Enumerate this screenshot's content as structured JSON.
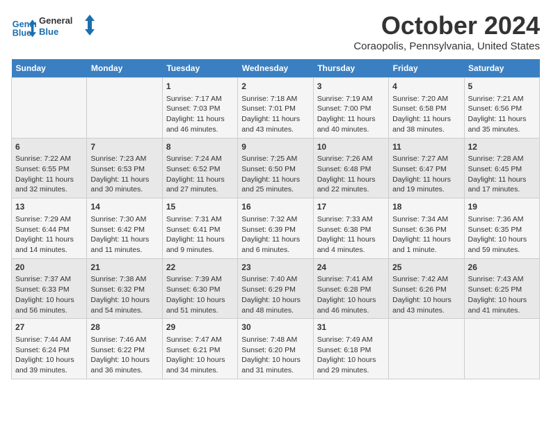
{
  "header": {
    "logo_line1": "General",
    "logo_line2": "Blue",
    "month": "October 2024",
    "location": "Coraopolis, Pennsylvania, United States"
  },
  "days_of_week": [
    "Sunday",
    "Monday",
    "Tuesday",
    "Wednesday",
    "Thursday",
    "Friday",
    "Saturday"
  ],
  "weeks": [
    [
      {
        "day": "",
        "content": ""
      },
      {
        "day": "",
        "content": ""
      },
      {
        "day": "1",
        "content": "Sunrise: 7:17 AM\nSunset: 7:03 PM\nDaylight: 11 hours and 46 minutes."
      },
      {
        "day": "2",
        "content": "Sunrise: 7:18 AM\nSunset: 7:01 PM\nDaylight: 11 hours and 43 minutes."
      },
      {
        "day": "3",
        "content": "Sunrise: 7:19 AM\nSunset: 7:00 PM\nDaylight: 11 hours and 40 minutes."
      },
      {
        "day": "4",
        "content": "Sunrise: 7:20 AM\nSunset: 6:58 PM\nDaylight: 11 hours and 38 minutes."
      },
      {
        "day": "5",
        "content": "Sunrise: 7:21 AM\nSunset: 6:56 PM\nDaylight: 11 hours and 35 minutes."
      }
    ],
    [
      {
        "day": "6",
        "content": "Sunrise: 7:22 AM\nSunset: 6:55 PM\nDaylight: 11 hours and 32 minutes."
      },
      {
        "day": "7",
        "content": "Sunrise: 7:23 AM\nSunset: 6:53 PM\nDaylight: 11 hours and 30 minutes."
      },
      {
        "day": "8",
        "content": "Sunrise: 7:24 AM\nSunset: 6:52 PM\nDaylight: 11 hours and 27 minutes."
      },
      {
        "day": "9",
        "content": "Sunrise: 7:25 AM\nSunset: 6:50 PM\nDaylight: 11 hours and 25 minutes."
      },
      {
        "day": "10",
        "content": "Sunrise: 7:26 AM\nSunset: 6:48 PM\nDaylight: 11 hours and 22 minutes."
      },
      {
        "day": "11",
        "content": "Sunrise: 7:27 AM\nSunset: 6:47 PM\nDaylight: 11 hours and 19 minutes."
      },
      {
        "day": "12",
        "content": "Sunrise: 7:28 AM\nSunset: 6:45 PM\nDaylight: 11 hours and 17 minutes."
      }
    ],
    [
      {
        "day": "13",
        "content": "Sunrise: 7:29 AM\nSunset: 6:44 PM\nDaylight: 11 hours and 14 minutes."
      },
      {
        "day": "14",
        "content": "Sunrise: 7:30 AM\nSunset: 6:42 PM\nDaylight: 11 hours and 11 minutes."
      },
      {
        "day": "15",
        "content": "Sunrise: 7:31 AM\nSunset: 6:41 PM\nDaylight: 11 hours and 9 minutes."
      },
      {
        "day": "16",
        "content": "Sunrise: 7:32 AM\nSunset: 6:39 PM\nDaylight: 11 hours and 6 minutes."
      },
      {
        "day": "17",
        "content": "Sunrise: 7:33 AM\nSunset: 6:38 PM\nDaylight: 11 hours and 4 minutes."
      },
      {
        "day": "18",
        "content": "Sunrise: 7:34 AM\nSunset: 6:36 PM\nDaylight: 11 hours and 1 minute."
      },
      {
        "day": "19",
        "content": "Sunrise: 7:36 AM\nSunset: 6:35 PM\nDaylight: 10 hours and 59 minutes."
      }
    ],
    [
      {
        "day": "20",
        "content": "Sunrise: 7:37 AM\nSunset: 6:33 PM\nDaylight: 10 hours and 56 minutes."
      },
      {
        "day": "21",
        "content": "Sunrise: 7:38 AM\nSunset: 6:32 PM\nDaylight: 10 hours and 54 minutes."
      },
      {
        "day": "22",
        "content": "Sunrise: 7:39 AM\nSunset: 6:30 PM\nDaylight: 10 hours and 51 minutes."
      },
      {
        "day": "23",
        "content": "Sunrise: 7:40 AM\nSunset: 6:29 PM\nDaylight: 10 hours and 48 minutes."
      },
      {
        "day": "24",
        "content": "Sunrise: 7:41 AM\nSunset: 6:28 PM\nDaylight: 10 hours and 46 minutes."
      },
      {
        "day": "25",
        "content": "Sunrise: 7:42 AM\nSunset: 6:26 PM\nDaylight: 10 hours and 43 minutes."
      },
      {
        "day": "26",
        "content": "Sunrise: 7:43 AM\nSunset: 6:25 PM\nDaylight: 10 hours and 41 minutes."
      }
    ],
    [
      {
        "day": "27",
        "content": "Sunrise: 7:44 AM\nSunset: 6:24 PM\nDaylight: 10 hours and 39 minutes."
      },
      {
        "day": "28",
        "content": "Sunrise: 7:46 AM\nSunset: 6:22 PM\nDaylight: 10 hours and 36 minutes."
      },
      {
        "day": "29",
        "content": "Sunrise: 7:47 AM\nSunset: 6:21 PM\nDaylight: 10 hours and 34 minutes."
      },
      {
        "day": "30",
        "content": "Sunrise: 7:48 AM\nSunset: 6:20 PM\nDaylight: 10 hours and 31 minutes."
      },
      {
        "day": "31",
        "content": "Sunrise: 7:49 AM\nSunset: 6:18 PM\nDaylight: 10 hours and 29 minutes."
      },
      {
        "day": "",
        "content": ""
      },
      {
        "day": "",
        "content": ""
      }
    ]
  ]
}
